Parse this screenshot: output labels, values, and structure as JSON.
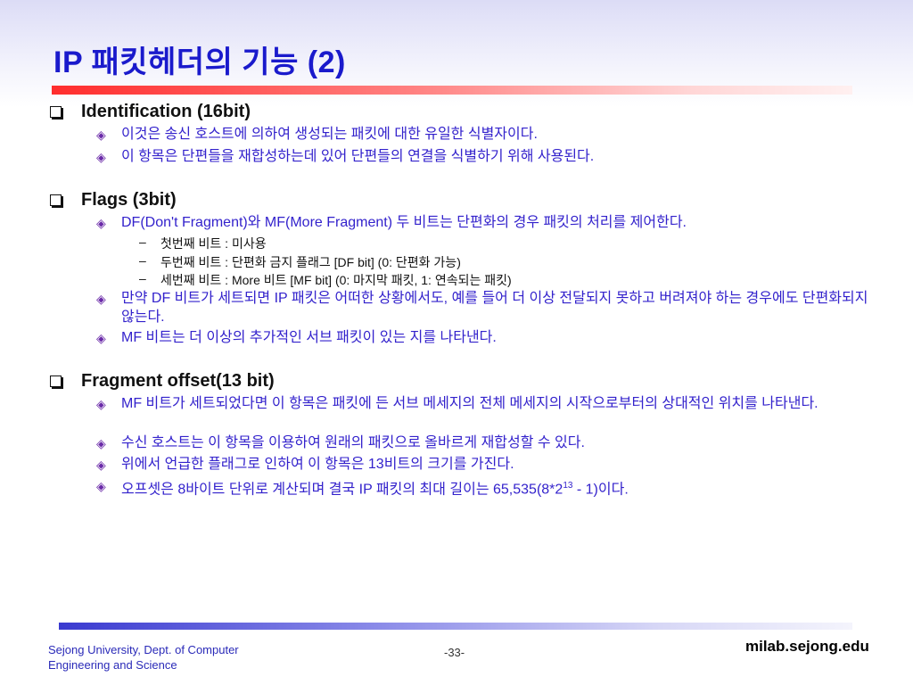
{
  "title": "IP 패킷헤더의 기능 (2)",
  "sections": [
    {
      "heading": "Identification (16bit)",
      "bullets": [
        "이것은 송신 호스트에 의하여 생성되는 패킷에 대한 유일한 식별자이다.",
        "이 항목은 단편들을 재합성하는데 있어 단편들의 연결을 식별하기 위해 사용된다."
      ]
    },
    {
      "heading": "Flags (3bit)",
      "bullet1": "DF(Don't Fragment)와 MF(More Fragment) 두 비트는 단편화의 경우 패킷의 처리를 제어한다.",
      "dashes": [
        "첫번째 비트 : 미사용",
        "두번째 비트 : 단편화 금지 플래그 [DF bit] (0: 단편화 가능)",
        "세번째 비트 : More 비트 [MF bit] (0: 마지막 패킷, 1: 연속되는 패킷)"
      ],
      "bullet2": "만약 DF 비트가 세트되면 IP 패킷은 어떠한 상황에서도, 예를 들어 더 이상 전달되지 못하고 버려져야 하는 경우에도 단편화되지 않는다.",
      "bullet3": "MF 비트는 더 이상의 추가적인 서브 패킷이 있는 지를 나타낸다."
    },
    {
      "heading": "Fragment offset(13 bit)",
      "bullets": [
        "MF 비트가 세트되었다면 이 항목은 패킷에 든 서브 메세지의 전체 메세지의 시작으로부터의 상대적인 위치를 나타낸다.",
        "수신 호스트는 이 항목을 이용하여 원래의 패킷으로 올바르게 재합성할 수 있다.",
        "위에서 언급한 플래그로 인하여 이 항목은 13비트의 크기를 가진다."
      ],
      "last_bullet": {
        "before": "오프셋은 8바이트 단위로 계산되며 결국 IP 패킷의 최대 길이는 65,535(8*2",
        "sup": "13",
        "after": " - 1)이다."
      }
    }
  ],
  "footer": {
    "left_line1": "Sejong University, Dept. of Computer",
    "left_line2": "Engineering and Science",
    "page": "-33-",
    "right": "milab.sejong.edu"
  },
  "colors": {
    "title": "#1a1acc",
    "bullet_text": "#3322cc",
    "title_bar": "#ff2d2d",
    "footer_bar": "#3a3ad0"
  },
  "icons": {
    "section_bullet": "checkbox-square-icon",
    "sub_bullet": "diamond-icon"
  }
}
